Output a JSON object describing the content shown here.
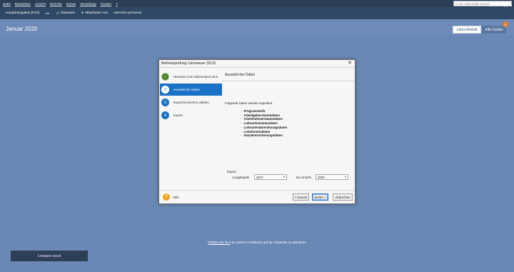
{
  "menubar": {
    "items": [
      "Datei",
      "Bearbeiten",
      "Ansicht",
      "Berichte",
      "Extras",
      "Verwaltung",
      "Fenster",
      "?"
    ],
    "search_placeholder": "In der Onlinehilfe suchen"
  },
  "toolbar": {
    "hauptnavigation": "Hauptnavigation [F10]",
    "startseite": "Startseite",
    "mitarbeiter_neu": "Mitarbeiter neu",
    "eservice": "eService personal",
    "online_support": "Online Support"
  },
  "header": {
    "month": "Januar 2020",
    "tab_lohn": "Lohn+Gehalt",
    "tab_info": "Info Center",
    "badge_count": "4"
  },
  "dialog": {
    "title": "Betriebsprüfung Lohnsteuer (DLS)",
    "close": "✕",
    "steps": [
      {
        "num": "1",
        "label": "Hinweise zum Datenexport DLS"
      },
      {
        "num": "2",
        "label": "Auswahl der Daten"
      },
      {
        "num": "3",
        "label": "Exportverzeichnis wählen"
      },
      {
        "num": "4",
        "label": "Export"
      }
    ],
    "content_title": "Auswahl der Daten",
    "intro": "Folgende Daten werden exportiert",
    "data_items": [
      "Programminfo",
      "Arbeitgeberstammdaten",
      "Arbeitnehmerstammdaten",
      "Lohnartenstammdaten",
      "Lohnartenabrechnungsdaten",
      "Lohnkontendaten",
      "Sozialversicherungsdaten"
    ],
    "export_label": "Export",
    "year_from_label": "Ausgabejahr",
    "year_from_value": "2017",
    "year_to_label": "bis einschl.",
    "year_to_value": "2020",
    "help_icon": "?",
    "help_label": "Hilfe",
    "back_label": "< Zurück",
    "next_label": "Weiter >",
    "cancel_label": "Abbrechen"
  },
  "footer": {
    "link_prefix": "*",
    "link_text": "Klicken Sie hier",
    "link_rest": " um weitere Funktionen auf der Startseite zu platzieren."
  },
  "scout": {
    "label": "Lexware scout"
  }
}
